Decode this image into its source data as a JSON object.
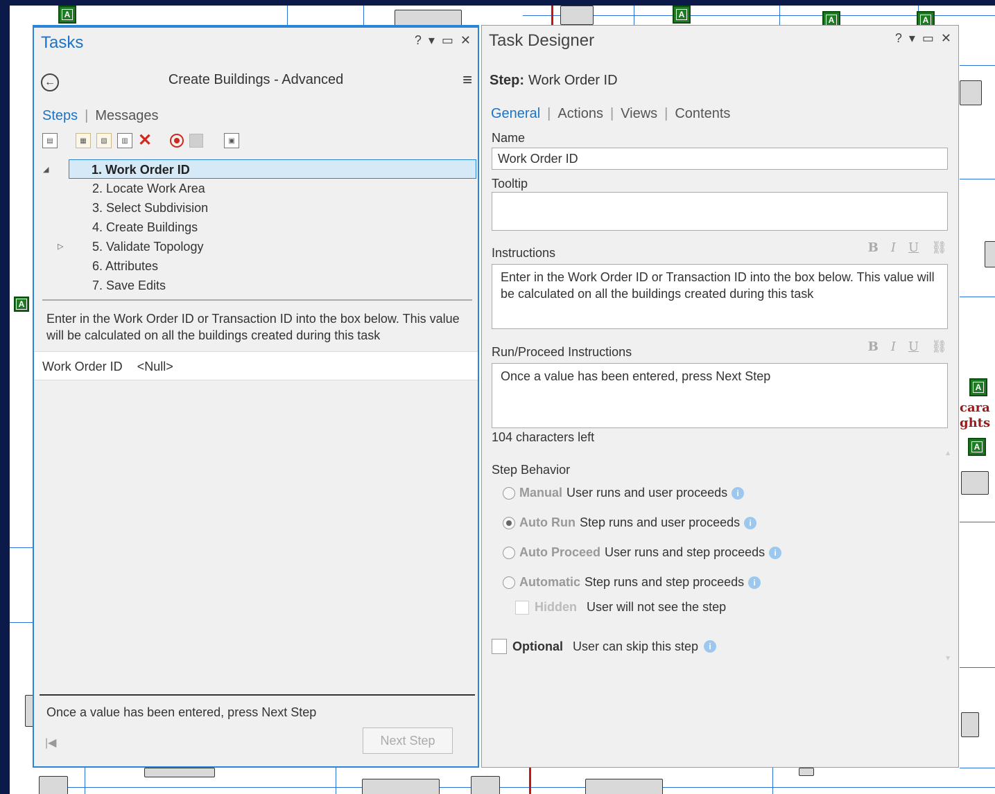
{
  "tasks_pane": {
    "title": "Tasks",
    "controls": {
      "help": "?",
      "dropdown": "▾",
      "restore": "▭",
      "close": "✕"
    },
    "task_name": "Create Buildings - Advanced",
    "tabs": {
      "steps": "Steps",
      "messages": "Messages"
    },
    "steps": [
      {
        "label": "1.  Work Order ID",
        "selected": true,
        "expander": "◢"
      },
      {
        "label": "2.  Locate Work Area"
      },
      {
        "label": "3.  Select Subdivision"
      },
      {
        "label": "4.  Create Buildings"
      },
      {
        "label": "5.  Validate Topology",
        "expander": "▷"
      },
      {
        "label": "6.  Attributes"
      },
      {
        "label": "7.  Save Edits"
      }
    ],
    "instructions": "Enter in the Work Order ID or Transaction ID into the box below. This value will be calculated on all the buildings created during this task",
    "field": {
      "name": "Work Order ID",
      "value": "<Null>"
    },
    "proceed_instructions": "Once a value has been entered, press Next Step",
    "next_step_label": "Next Step",
    "first_step_icon": "|◀"
  },
  "designer_pane": {
    "title": "Task Designer",
    "controls": {
      "help": "?",
      "dropdown": "▾",
      "restore": "▭",
      "close": "✕"
    },
    "step_label": "Step:",
    "step_name": "Work Order ID",
    "tabs": {
      "general": "General",
      "actions": "Actions",
      "views": "Views",
      "contents": "Contents"
    },
    "name_label": "Name",
    "name_value": "Work Order ID",
    "tooltip_label": "Tooltip",
    "tooltip_value": "",
    "instructions_label": "Instructions",
    "instructions_value": "Enter in the Work Order ID or Transaction ID into the box below. This value will be calculated on all the buildings created during this task",
    "run_label": "Run/Proceed Instructions",
    "run_value": "Once a value has been entered, press Next Step",
    "format": {
      "bold": "B",
      "italic": "I",
      "underline": "U"
    },
    "chars_left": "104 characters left",
    "behavior_title": "Step Behavior",
    "behaviors": [
      {
        "name": "Manual",
        "desc": "User runs and user proceeds",
        "selected": false
      },
      {
        "name": "Auto Run",
        "desc": "Step runs and user proceeds",
        "selected": true
      },
      {
        "name": "Auto Proceed",
        "desc": "User runs and step proceeds",
        "selected": false
      },
      {
        "name": "Automatic",
        "desc": "Step runs and step proceeds",
        "selected": false
      }
    ],
    "hidden": {
      "name": "Hidden",
      "desc": "User will not see the step"
    },
    "optional": {
      "name": "Optional",
      "desc": "User can skip this step"
    }
  },
  "map": {
    "label_1": "cara",
    "label_2": "ghts",
    "symbol_letter": "A"
  }
}
